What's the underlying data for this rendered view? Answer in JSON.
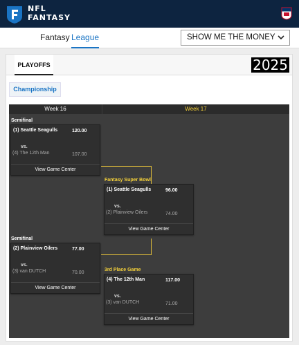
{
  "brand": {
    "line1": "NFL",
    "line2": "FANTASY"
  },
  "nav": {
    "fantasy": "Fantasy",
    "league": "League"
  },
  "money_select": {
    "selected": "SHOW ME THE MONEY"
  },
  "panel": {
    "tab": "PLAYOFFS",
    "year": "2025",
    "bracket_button": "Championship"
  },
  "bracket": {
    "week_a": "Week 16",
    "week_b": "Week 17",
    "rounds": {
      "semi1": "Semifinal",
      "semi2": "Semifinal",
      "superbowl": "Fantasy Super Bowl",
      "third": "3rd Place Game"
    },
    "games": {
      "semi1": {
        "top_team": "(1) Seattle Seagulls",
        "top_score": "120.00",
        "vs": "vs.",
        "bottom_team": "(4) The 12th Man",
        "bottom_score": "107.00",
        "link": "View Game Center"
      },
      "semi2": {
        "top_team": "(2) Plainview Oilers",
        "top_score": "77.00",
        "vs": "vs.",
        "bottom_team": "(3) van DUTCH",
        "bottom_score": "70.00",
        "link": "View Game Center"
      },
      "final": {
        "top_team": "(1) Seattle Seagulls",
        "top_score": "96.00",
        "vs": "vs.",
        "bottom_team": "(2) Plainview Oilers",
        "bottom_score": "74.00",
        "link": "View Game Center"
      },
      "third": {
        "top_team": "(4) The 12th Man",
        "top_score": "117.00",
        "vs": "vs.",
        "bottom_team": "(3) van DUTCH",
        "bottom_score": "71.00",
        "link": "View Game Center"
      }
    }
  },
  "colors": {
    "navy": "#0d2440",
    "accent_blue": "#1a74c4",
    "gold": "#f6d23a"
  }
}
